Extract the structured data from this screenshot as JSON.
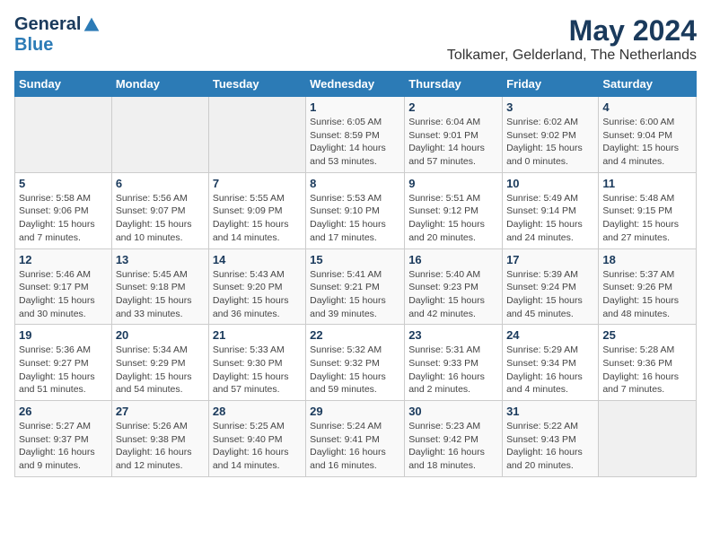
{
  "header": {
    "logo": {
      "general": "General",
      "blue": "Blue"
    },
    "title": "May 2024",
    "subtitle": "Tolkamer, Gelderland, The Netherlands"
  },
  "weekdays": [
    "Sunday",
    "Monday",
    "Tuesday",
    "Wednesday",
    "Thursday",
    "Friday",
    "Saturday"
  ],
  "weeks": [
    [
      {
        "day": "",
        "info": ""
      },
      {
        "day": "",
        "info": ""
      },
      {
        "day": "",
        "info": ""
      },
      {
        "day": "1",
        "info": "Sunrise: 6:05 AM\nSunset: 8:59 PM\nDaylight: 14 hours\nand 53 minutes."
      },
      {
        "day": "2",
        "info": "Sunrise: 6:04 AM\nSunset: 9:01 PM\nDaylight: 14 hours\nand 57 minutes."
      },
      {
        "day": "3",
        "info": "Sunrise: 6:02 AM\nSunset: 9:02 PM\nDaylight: 15 hours\nand 0 minutes."
      },
      {
        "day": "4",
        "info": "Sunrise: 6:00 AM\nSunset: 9:04 PM\nDaylight: 15 hours\nand 4 minutes."
      }
    ],
    [
      {
        "day": "5",
        "info": "Sunrise: 5:58 AM\nSunset: 9:06 PM\nDaylight: 15 hours\nand 7 minutes."
      },
      {
        "day": "6",
        "info": "Sunrise: 5:56 AM\nSunset: 9:07 PM\nDaylight: 15 hours\nand 10 minutes."
      },
      {
        "day": "7",
        "info": "Sunrise: 5:55 AM\nSunset: 9:09 PM\nDaylight: 15 hours\nand 14 minutes."
      },
      {
        "day": "8",
        "info": "Sunrise: 5:53 AM\nSunset: 9:10 PM\nDaylight: 15 hours\nand 17 minutes."
      },
      {
        "day": "9",
        "info": "Sunrise: 5:51 AM\nSunset: 9:12 PM\nDaylight: 15 hours\nand 20 minutes."
      },
      {
        "day": "10",
        "info": "Sunrise: 5:49 AM\nSunset: 9:14 PM\nDaylight: 15 hours\nand 24 minutes."
      },
      {
        "day": "11",
        "info": "Sunrise: 5:48 AM\nSunset: 9:15 PM\nDaylight: 15 hours\nand 27 minutes."
      }
    ],
    [
      {
        "day": "12",
        "info": "Sunrise: 5:46 AM\nSunset: 9:17 PM\nDaylight: 15 hours\nand 30 minutes."
      },
      {
        "day": "13",
        "info": "Sunrise: 5:45 AM\nSunset: 9:18 PM\nDaylight: 15 hours\nand 33 minutes."
      },
      {
        "day": "14",
        "info": "Sunrise: 5:43 AM\nSunset: 9:20 PM\nDaylight: 15 hours\nand 36 minutes."
      },
      {
        "day": "15",
        "info": "Sunrise: 5:41 AM\nSunset: 9:21 PM\nDaylight: 15 hours\nand 39 minutes."
      },
      {
        "day": "16",
        "info": "Sunrise: 5:40 AM\nSunset: 9:23 PM\nDaylight: 15 hours\nand 42 minutes."
      },
      {
        "day": "17",
        "info": "Sunrise: 5:39 AM\nSunset: 9:24 PM\nDaylight: 15 hours\nand 45 minutes."
      },
      {
        "day": "18",
        "info": "Sunrise: 5:37 AM\nSunset: 9:26 PM\nDaylight: 15 hours\nand 48 minutes."
      }
    ],
    [
      {
        "day": "19",
        "info": "Sunrise: 5:36 AM\nSunset: 9:27 PM\nDaylight: 15 hours\nand 51 minutes."
      },
      {
        "day": "20",
        "info": "Sunrise: 5:34 AM\nSunset: 9:29 PM\nDaylight: 15 hours\nand 54 minutes."
      },
      {
        "day": "21",
        "info": "Sunrise: 5:33 AM\nSunset: 9:30 PM\nDaylight: 15 hours\nand 57 minutes."
      },
      {
        "day": "22",
        "info": "Sunrise: 5:32 AM\nSunset: 9:32 PM\nDaylight: 15 hours\nand 59 minutes."
      },
      {
        "day": "23",
        "info": "Sunrise: 5:31 AM\nSunset: 9:33 PM\nDaylight: 16 hours\nand 2 minutes."
      },
      {
        "day": "24",
        "info": "Sunrise: 5:29 AM\nSunset: 9:34 PM\nDaylight: 16 hours\nand 4 minutes."
      },
      {
        "day": "25",
        "info": "Sunrise: 5:28 AM\nSunset: 9:36 PM\nDaylight: 16 hours\nand 7 minutes."
      }
    ],
    [
      {
        "day": "26",
        "info": "Sunrise: 5:27 AM\nSunset: 9:37 PM\nDaylight: 16 hours\nand 9 minutes."
      },
      {
        "day": "27",
        "info": "Sunrise: 5:26 AM\nSunset: 9:38 PM\nDaylight: 16 hours\nand 12 minutes."
      },
      {
        "day": "28",
        "info": "Sunrise: 5:25 AM\nSunset: 9:40 PM\nDaylight: 16 hours\nand 14 minutes."
      },
      {
        "day": "29",
        "info": "Sunrise: 5:24 AM\nSunset: 9:41 PM\nDaylight: 16 hours\nand 16 minutes."
      },
      {
        "day": "30",
        "info": "Sunrise: 5:23 AM\nSunset: 9:42 PM\nDaylight: 16 hours\nand 18 minutes."
      },
      {
        "day": "31",
        "info": "Sunrise: 5:22 AM\nSunset: 9:43 PM\nDaylight: 16 hours\nand 20 minutes."
      },
      {
        "day": "",
        "info": ""
      }
    ]
  ]
}
